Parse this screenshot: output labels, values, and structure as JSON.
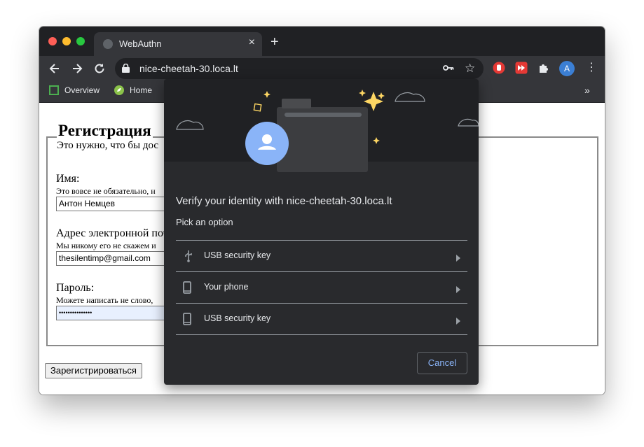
{
  "browser": {
    "tab_title": "WebAuthn",
    "close_glyph": "×",
    "new_tab_glyph": "+",
    "url": "nice-cheetah-30.loca.lt",
    "profile_initial": "A",
    "more_glyph": "»",
    "bookmarks": [
      {
        "label": "Overview",
        "icon": "overview-icon",
        "color": "#4caf50"
      },
      {
        "label": "Home",
        "icon": "home-leaf-icon",
        "color": "#8bc34a"
      }
    ],
    "traffic_lights": [
      "#ff5f57",
      "#febc2e",
      "#28c840"
    ],
    "extensions": [
      "stop-hand-icon",
      "fast-forward-icon",
      "puzzle-icon"
    ]
  },
  "page": {
    "heading": "Регистрация",
    "intro": "Это нужно, что бы дос",
    "name_label": "Имя:",
    "name_hint": "Это вовсе не обязательно, н",
    "name_value": "Антон Немцев",
    "email_label": "Адрес электронной поч",
    "email_hint": "Мы никому его не скажем и",
    "email_value": "thesilentimp@gmail.com",
    "password_label": "Пароль:",
    "password_hint": "Можете написать не слово,",
    "password_value": "•••••••••••••••",
    "submit_label": "Зарегистрироваться"
  },
  "dialog": {
    "title": "Verify your identity with nice-cheetah-30.loca.lt",
    "subtitle": "Pick an option",
    "options": [
      {
        "label": "USB security key",
        "icon": "usb-icon"
      },
      {
        "label": "Your phone",
        "icon": "phone-icon"
      },
      {
        "label": "USB security key",
        "icon": "phone-icon"
      }
    ],
    "cancel_label": "Cancel",
    "accent_color": "#8ab4f8",
    "sparkle_color": "#fdd663"
  }
}
